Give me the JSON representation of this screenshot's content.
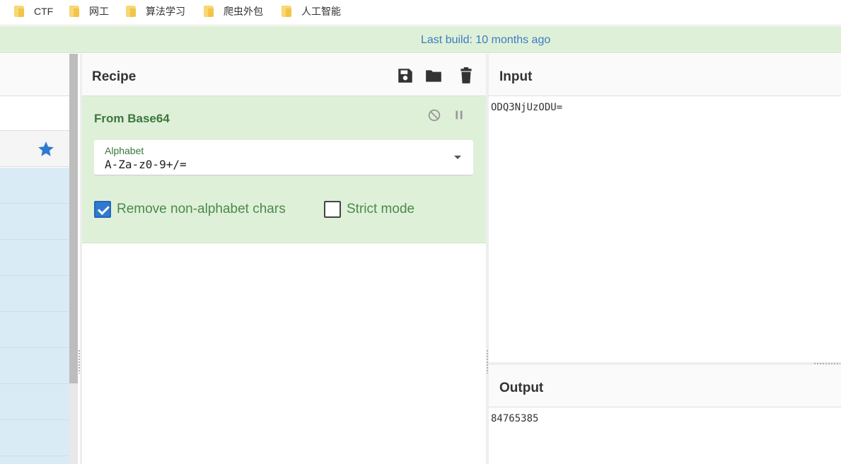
{
  "bookmarks": [
    {
      "label": "CTF"
    },
    {
      "label": "网工"
    },
    {
      "label": "算法学习"
    },
    {
      "label": "爬虫外包"
    },
    {
      "label": "人工智能"
    }
  ],
  "banner": {
    "text": "Last build: 10 months ago"
  },
  "recipe": {
    "title": "Recipe",
    "icons": [
      "save-icon",
      "folder-icon",
      "trash-icon"
    ],
    "operation": {
      "name": "From Base64",
      "alphabet_label": "Alphabet",
      "alphabet_value": "A-Za-z0-9+/=",
      "remove_non_alphabet_label": "Remove non-alphabet chars",
      "remove_non_alphabet_checked": true,
      "strict_mode_label": "Strict mode",
      "strict_mode_checked": false
    }
  },
  "input": {
    "title": "Input",
    "value": "ODQ3NjUzODU="
  },
  "output": {
    "title": "Output",
    "value": "84765385"
  },
  "colors": {
    "accent": "#2f7ad0",
    "op_bg": "#dff0d8",
    "op_text": "#3c763d",
    "banner_text": "#3a7cc2",
    "list_bg": "#d9ecf6"
  }
}
